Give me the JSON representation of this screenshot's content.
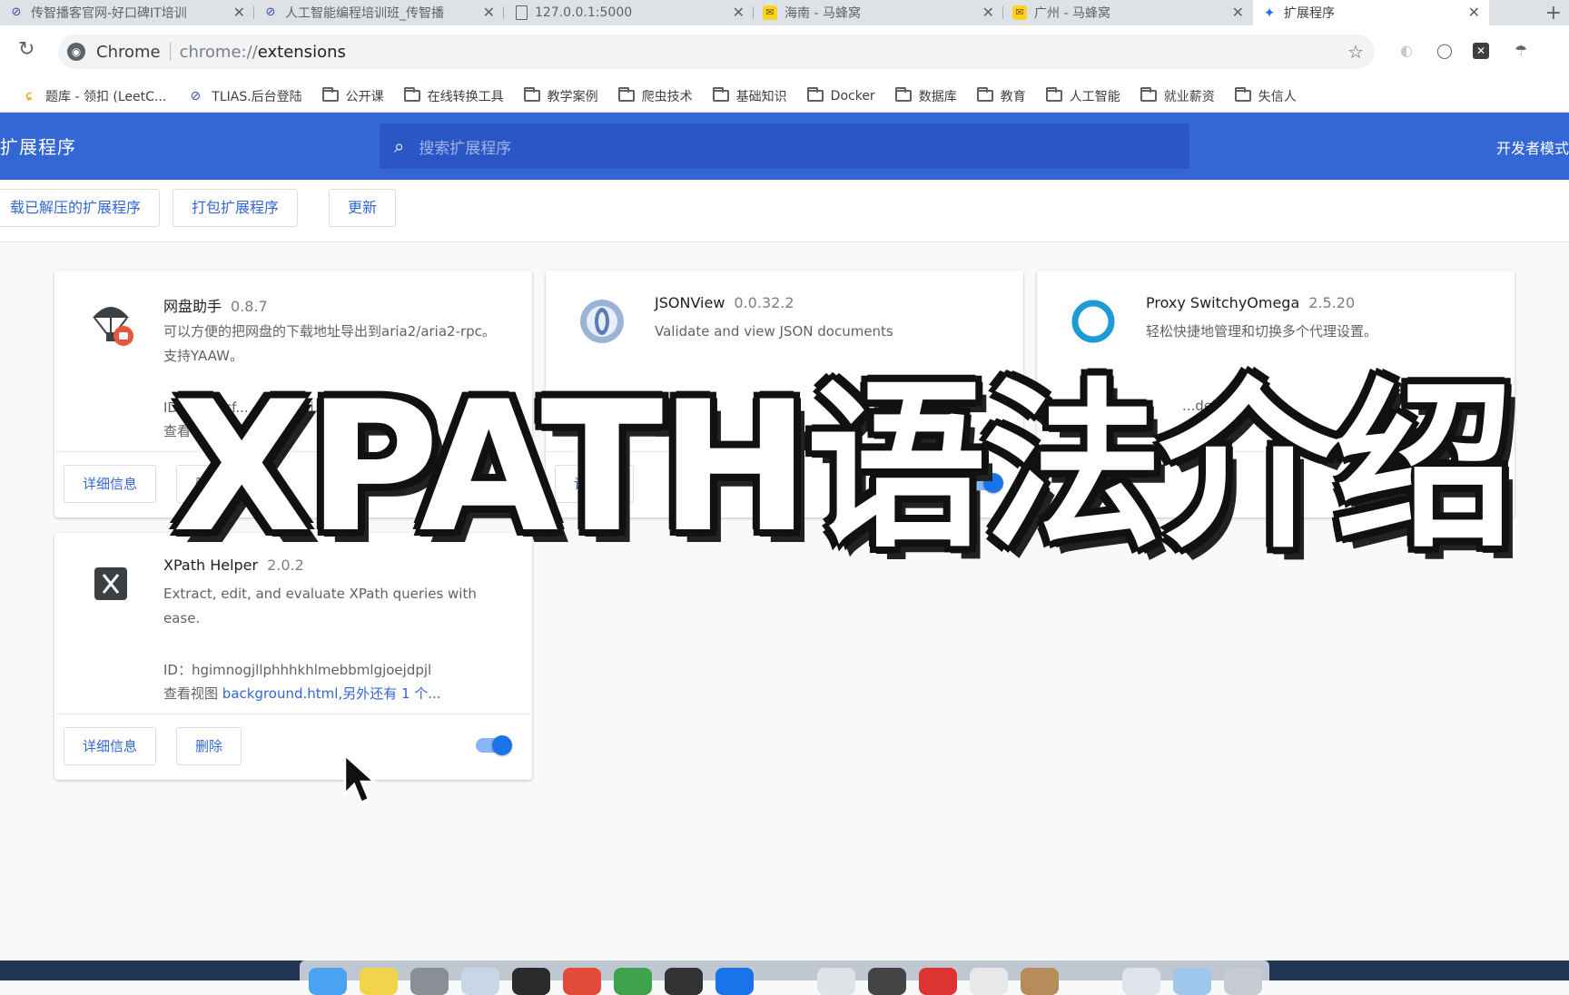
{
  "tabs": [
    {
      "title": "传智播客官网-好口碑IT培训",
      "favicon": "ring-logo"
    },
    {
      "title": "人工智能编程培训班_传智播",
      "favicon": "ring-logo"
    },
    {
      "title": "127.0.0.1:5000",
      "favicon": "page-icon"
    },
    {
      "title": "海南 - 马蜂窝",
      "favicon": "mafengwo-logo"
    },
    {
      "title": "广州 - 马蜂窝",
      "favicon": "mafengwo-logo"
    },
    {
      "title": "扩展程序",
      "favicon": "puzzle-icon",
      "active": true
    }
  ],
  "omnibox": {
    "chip": "Chrome",
    "scheme": "chrome://",
    "host": "extensions"
  },
  "bookmarks": [
    {
      "label": "题库 - 领扣 (LeetC...",
      "icon": "leetcode-icon"
    },
    {
      "label": "TLIAS.后台登陆",
      "icon": "ring-logo"
    },
    {
      "label": "公开课",
      "icon": "folder-icon"
    },
    {
      "label": "在线转换工具",
      "icon": "folder-icon"
    },
    {
      "label": "教学案例",
      "icon": "folder-icon"
    },
    {
      "label": "爬虫技术",
      "icon": "folder-icon"
    },
    {
      "label": "基础知识",
      "icon": "folder-icon"
    },
    {
      "label": "Docker",
      "icon": "folder-icon"
    },
    {
      "label": "数据库",
      "icon": "folder-icon"
    },
    {
      "label": "教育",
      "icon": "folder-icon"
    },
    {
      "label": "人工智能",
      "icon": "folder-icon"
    },
    {
      "label": "就业薪资",
      "icon": "folder-icon"
    },
    {
      "label": "失信人",
      "icon": "folder-icon"
    }
  ],
  "header": {
    "title": "扩展程序",
    "search_placeholder": "搜索扩展程序",
    "developer_mode": "开发者模式"
  },
  "toolbar_buttons": {
    "load_unpacked": "载已解压的扩展程序",
    "pack": "打包扩展程序",
    "update": "更新"
  },
  "extensions": [
    {
      "name": "网盘助手",
      "version": "0.8.7",
      "description": "可以方便的把网盘的下载地址导出到aria2/aria2-rpc。支持YAAW。",
      "id_label": "ID：",
      "id": "ceaacf... ...ncpocji",
      "views_label": "查看",
      "views_link": "",
      "details": "详细信息",
      "remove": "删除",
      "enabled": true
    },
    {
      "name": "JSONView",
      "version": "0.0.32.2",
      "description": "Validate and view JSON documents",
      "id_label": "ID：",
      "id": "c...k",
      "views_label": "查看",
      "views_link": "",
      "details": "详细信",
      "remove": "",
      "enabled": true
    },
    {
      "name": "Proxy SwitchyOmega",
      "version": "2.5.20",
      "description": "轻松快捷地管理和切换多个代理设置。",
      "id_label": "",
      "id": "...dekgcemlo",
      "views_label": "",
      "views_link": "backg",
      "details": "详细信",
      "remove": "",
      "enabled": true
    },
    {
      "name": "XPath Helper",
      "version": "2.0.2",
      "description": "Extract, edit, and evaluate XPath queries with ease.",
      "id_label": "ID：",
      "id": "hgimnogjllphhhkhlmebbmlgjoejdpjl",
      "views_label": "查看视图",
      "views_link": "background.html,另外还有 1 个...",
      "details": "详细信息",
      "remove": "删除",
      "enabled": true
    }
  ],
  "overlay_title": "XPATH语法介绍",
  "colors": {
    "header_blue": "#3367d6",
    "link_blue": "#3367d6",
    "toggle_blue": "#1a73e8"
  }
}
